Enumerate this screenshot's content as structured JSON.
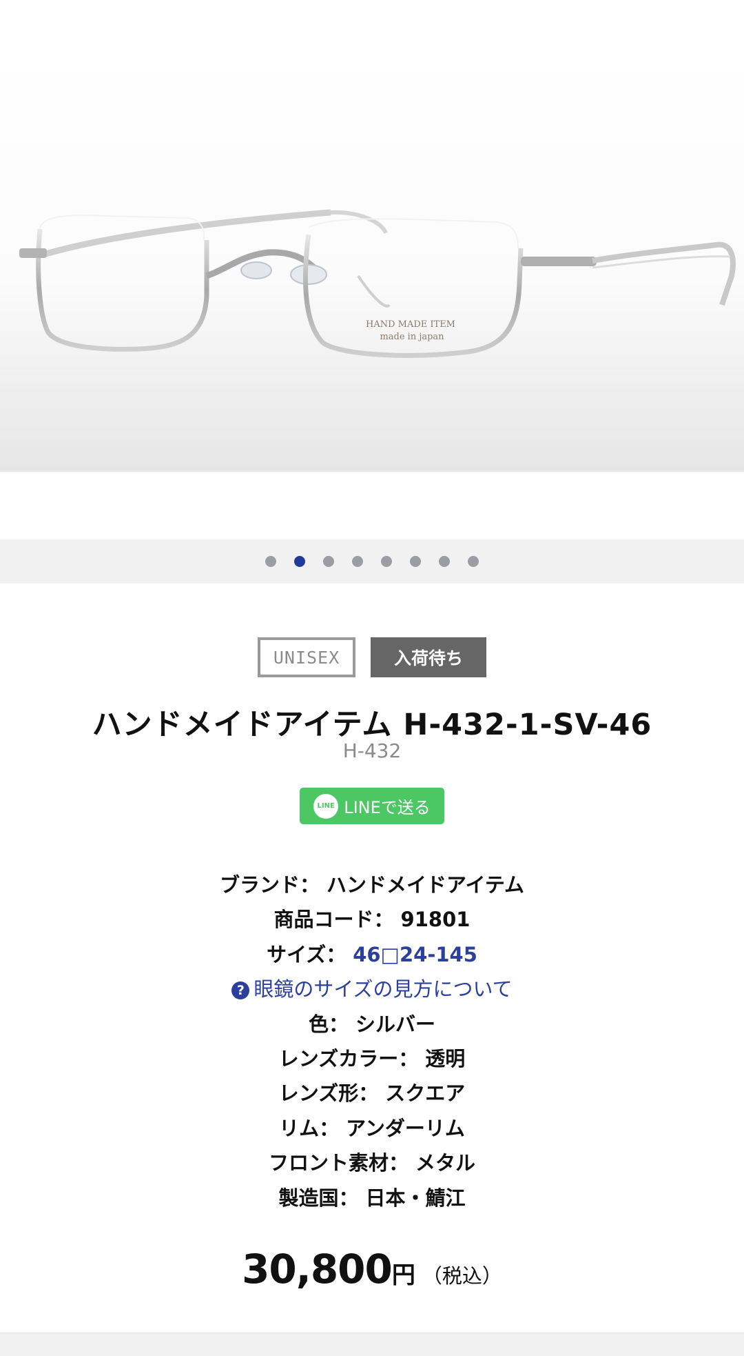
{
  "hero": {
    "engraving_line1": "HAND MADE ITEM",
    "engraving_line2": "made in japan"
  },
  "carousel": {
    "count": 8,
    "active_index": 1
  },
  "badges": {
    "gender": "UNISEX",
    "stock": "入荷待ち"
  },
  "product": {
    "title": "ハンドメイドアイテム H-432-1-SV-46",
    "model": "H-432"
  },
  "share": {
    "line_icon": "LINE",
    "line_label": "LINEで送る"
  },
  "specs": {
    "brand_label": "ブランド：",
    "brand_value": "ハンドメイドアイテム",
    "code_label": "商品コード：",
    "code_value": "91801",
    "size_label": "サイズ：",
    "size_value": "46□24-145",
    "size_help": "眼鏡のサイズの見方について",
    "color_label": "色：",
    "color_value": "シルバー",
    "lens_color_label": "レンズカラー：",
    "lens_color_value": "透明",
    "lens_shape_label": "レンズ形：",
    "lens_shape_value": "スクエア",
    "rim_label": "リム：",
    "rim_value": "アンダーリム",
    "front_material_label": "フロント素材：",
    "front_material_value": "メタル",
    "country_label": "製造国：",
    "country_value": "日本・鯖江"
  },
  "price": {
    "amount": "30,800",
    "currency": "円",
    "tax_note": "（税込）"
  },
  "colors": {
    "accent": "#23399a",
    "link": "#2b3f9c",
    "line_green": "#4cc764",
    "badge_gray": "#666666"
  }
}
